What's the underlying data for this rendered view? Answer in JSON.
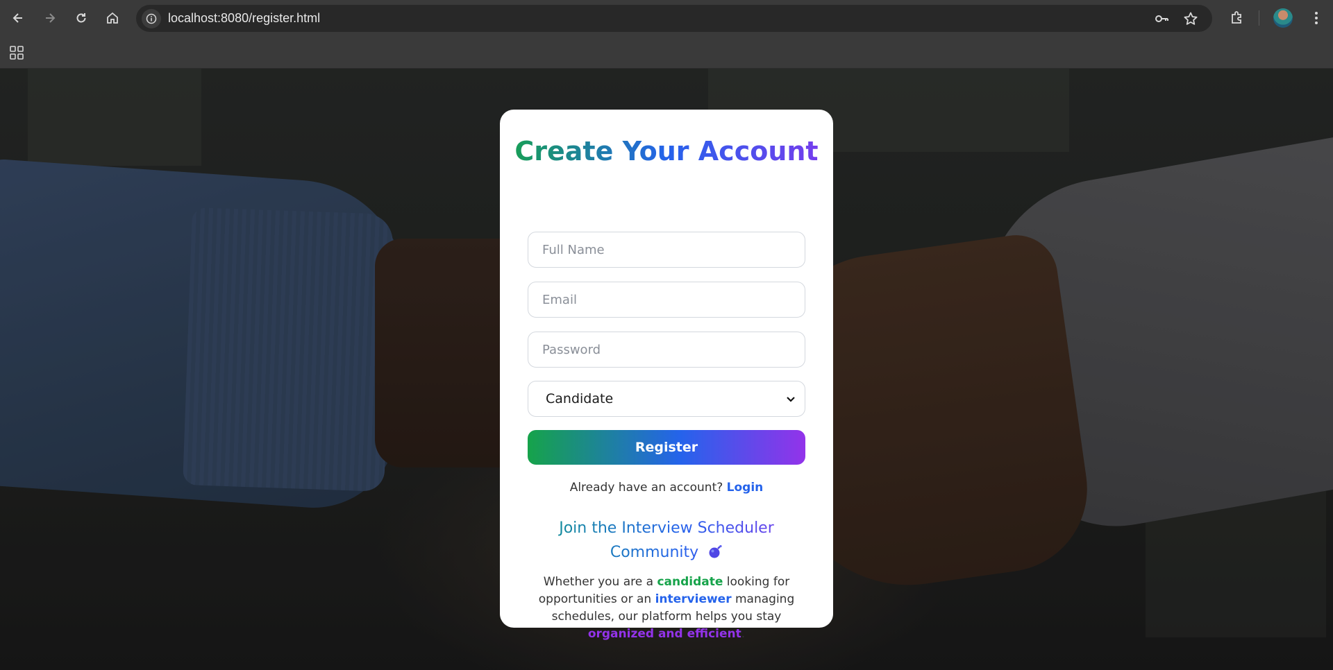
{
  "browser": {
    "url": "localhost:8080/register.html",
    "icons": [
      "back-icon",
      "forward-icon",
      "reload-icon",
      "home-icon",
      "site-info-icon",
      "password-key-icon",
      "bookmark-star-icon",
      "extensions-icon",
      "profile-avatar",
      "menu-dots-icon",
      "apps-grid-icon"
    ]
  },
  "form": {
    "title": "Create Your Account",
    "full_name_placeholder": "Full Name",
    "email_placeholder": "Email",
    "password_placeholder": "Password",
    "role_selected": "Candidate",
    "register_label": "Register",
    "login_prompt": "Already have an account?",
    "login_link": "Login"
  },
  "community": {
    "title_line1": "Join the Interview Scheduler",
    "title_line2": "Community",
    "desc": {
      "part1": "Whether you are a ",
      "candidate": "candidate",
      "part2": " looking for opportunities or an ",
      "interviewer": "interviewer",
      "part3": " managing schedules, our platform helps you stay ",
      "organized": "organized and efficient",
      "part4": "."
    }
  },
  "colors": {
    "accent_green": "#16a34a",
    "accent_blue": "#2563eb",
    "accent_purple": "#9333ea"
  }
}
